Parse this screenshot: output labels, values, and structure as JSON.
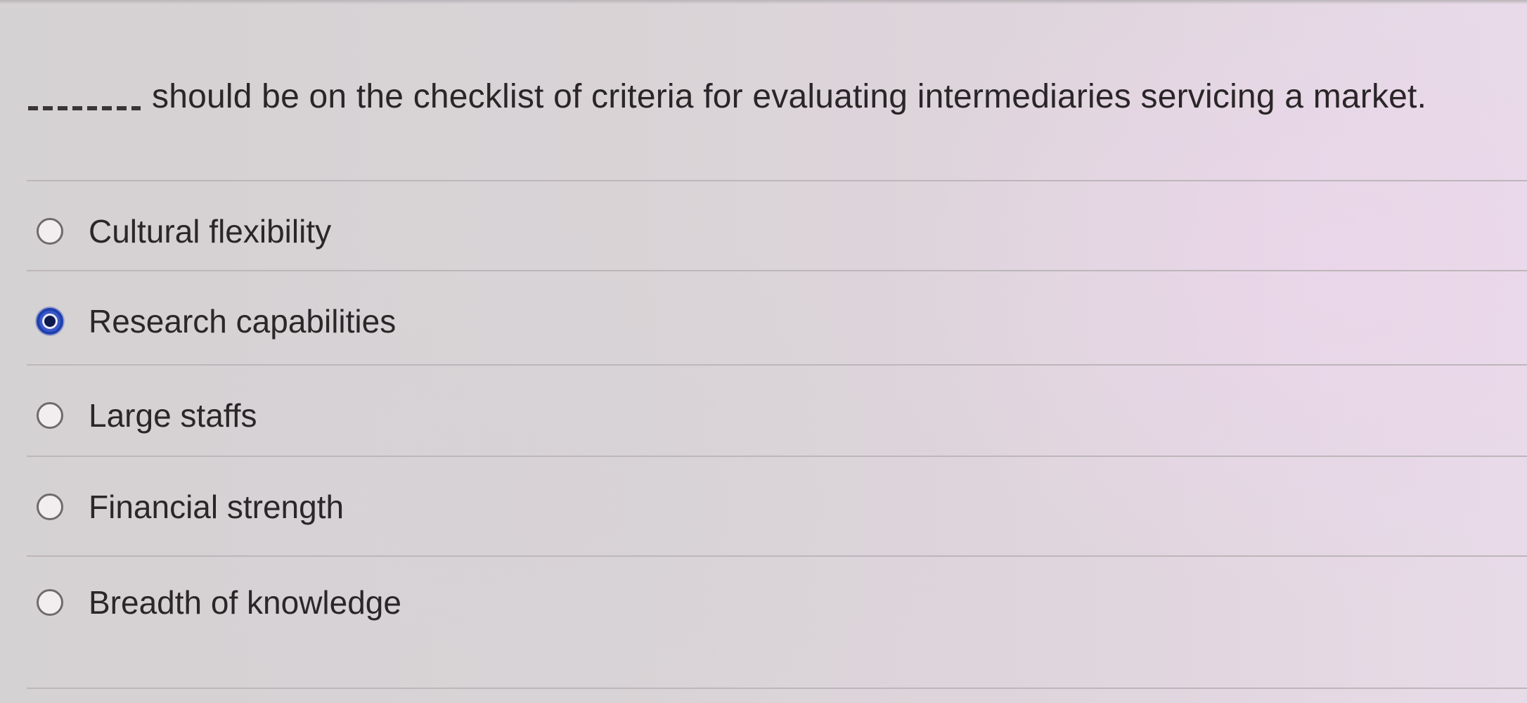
{
  "question": {
    "blank": "________",
    "text": "should be on the checklist of criteria for evaluating intermediaries servicing a market."
  },
  "options": [
    {
      "label": "Cultural flexibility",
      "selected": false
    },
    {
      "label": "Research capabilities",
      "selected": true
    },
    {
      "label": "Large staffs",
      "selected": false
    },
    {
      "label": "Financial strength",
      "selected": false
    },
    {
      "label": "Breadth of knowledge",
      "selected": false
    }
  ],
  "colors": {
    "selected_radio": "#1f3fae",
    "background": "#d8d3d6",
    "text": "#2a2628"
  }
}
